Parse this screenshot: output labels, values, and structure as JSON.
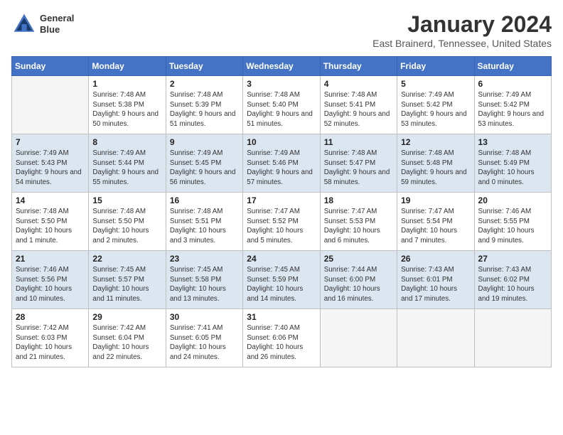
{
  "header": {
    "logo_line1": "General",
    "logo_line2": "Blue",
    "month": "January 2024",
    "location": "East Brainerd, Tennessee, United States"
  },
  "weekdays": [
    "Sunday",
    "Monday",
    "Tuesday",
    "Wednesday",
    "Thursday",
    "Friday",
    "Saturday"
  ],
  "weeks": [
    [
      {
        "day": "",
        "sunrise": "",
        "sunset": "",
        "daylight": ""
      },
      {
        "day": "1",
        "sunrise": "Sunrise: 7:48 AM",
        "sunset": "Sunset: 5:38 PM",
        "daylight": "Daylight: 9 hours and 50 minutes."
      },
      {
        "day": "2",
        "sunrise": "Sunrise: 7:48 AM",
        "sunset": "Sunset: 5:39 PM",
        "daylight": "Daylight: 9 hours and 51 minutes."
      },
      {
        "day": "3",
        "sunrise": "Sunrise: 7:48 AM",
        "sunset": "Sunset: 5:40 PM",
        "daylight": "Daylight: 9 hours and 51 minutes."
      },
      {
        "day": "4",
        "sunrise": "Sunrise: 7:48 AM",
        "sunset": "Sunset: 5:41 PM",
        "daylight": "Daylight: 9 hours and 52 minutes."
      },
      {
        "day": "5",
        "sunrise": "Sunrise: 7:49 AM",
        "sunset": "Sunset: 5:42 PM",
        "daylight": "Daylight: 9 hours and 53 minutes."
      },
      {
        "day": "6",
        "sunrise": "Sunrise: 7:49 AM",
        "sunset": "Sunset: 5:42 PM",
        "daylight": "Daylight: 9 hours and 53 minutes."
      }
    ],
    [
      {
        "day": "7",
        "sunrise": "Sunrise: 7:49 AM",
        "sunset": "Sunset: 5:43 PM",
        "daylight": "Daylight: 9 hours and 54 minutes."
      },
      {
        "day": "8",
        "sunrise": "Sunrise: 7:49 AM",
        "sunset": "Sunset: 5:44 PM",
        "daylight": "Daylight: 9 hours and 55 minutes."
      },
      {
        "day": "9",
        "sunrise": "Sunrise: 7:49 AM",
        "sunset": "Sunset: 5:45 PM",
        "daylight": "Daylight: 9 hours and 56 minutes."
      },
      {
        "day": "10",
        "sunrise": "Sunrise: 7:49 AM",
        "sunset": "Sunset: 5:46 PM",
        "daylight": "Daylight: 9 hours and 57 minutes."
      },
      {
        "day": "11",
        "sunrise": "Sunrise: 7:48 AM",
        "sunset": "Sunset: 5:47 PM",
        "daylight": "Daylight: 9 hours and 58 minutes."
      },
      {
        "day": "12",
        "sunrise": "Sunrise: 7:48 AM",
        "sunset": "Sunset: 5:48 PM",
        "daylight": "Daylight: 9 hours and 59 minutes."
      },
      {
        "day": "13",
        "sunrise": "Sunrise: 7:48 AM",
        "sunset": "Sunset: 5:49 PM",
        "daylight": "Daylight: 10 hours and 0 minutes."
      }
    ],
    [
      {
        "day": "14",
        "sunrise": "Sunrise: 7:48 AM",
        "sunset": "Sunset: 5:50 PM",
        "daylight": "Daylight: 10 hours and 1 minute."
      },
      {
        "day": "15",
        "sunrise": "Sunrise: 7:48 AM",
        "sunset": "Sunset: 5:50 PM",
        "daylight": "Daylight: 10 hours and 2 minutes."
      },
      {
        "day": "16",
        "sunrise": "Sunrise: 7:48 AM",
        "sunset": "Sunset: 5:51 PM",
        "daylight": "Daylight: 10 hours and 3 minutes."
      },
      {
        "day": "17",
        "sunrise": "Sunrise: 7:47 AM",
        "sunset": "Sunset: 5:52 PM",
        "daylight": "Daylight: 10 hours and 5 minutes."
      },
      {
        "day": "18",
        "sunrise": "Sunrise: 7:47 AM",
        "sunset": "Sunset: 5:53 PM",
        "daylight": "Daylight: 10 hours and 6 minutes."
      },
      {
        "day": "19",
        "sunrise": "Sunrise: 7:47 AM",
        "sunset": "Sunset: 5:54 PM",
        "daylight": "Daylight: 10 hours and 7 minutes."
      },
      {
        "day": "20",
        "sunrise": "Sunrise: 7:46 AM",
        "sunset": "Sunset: 5:55 PM",
        "daylight": "Daylight: 10 hours and 9 minutes."
      }
    ],
    [
      {
        "day": "21",
        "sunrise": "Sunrise: 7:46 AM",
        "sunset": "Sunset: 5:56 PM",
        "daylight": "Daylight: 10 hours and 10 minutes."
      },
      {
        "day": "22",
        "sunrise": "Sunrise: 7:45 AM",
        "sunset": "Sunset: 5:57 PM",
        "daylight": "Daylight: 10 hours and 11 minutes."
      },
      {
        "day": "23",
        "sunrise": "Sunrise: 7:45 AM",
        "sunset": "Sunset: 5:58 PM",
        "daylight": "Daylight: 10 hours and 13 minutes."
      },
      {
        "day": "24",
        "sunrise": "Sunrise: 7:45 AM",
        "sunset": "Sunset: 5:59 PM",
        "daylight": "Daylight: 10 hours and 14 minutes."
      },
      {
        "day": "25",
        "sunrise": "Sunrise: 7:44 AM",
        "sunset": "Sunset: 6:00 PM",
        "daylight": "Daylight: 10 hours and 16 minutes."
      },
      {
        "day": "26",
        "sunrise": "Sunrise: 7:43 AM",
        "sunset": "Sunset: 6:01 PM",
        "daylight": "Daylight: 10 hours and 17 minutes."
      },
      {
        "day": "27",
        "sunrise": "Sunrise: 7:43 AM",
        "sunset": "Sunset: 6:02 PM",
        "daylight": "Daylight: 10 hours and 19 minutes."
      }
    ],
    [
      {
        "day": "28",
        "sunrise": "Sunrise: 7:42 AM",
        "sunset": "Sunset: 6:03 PM",
        "daylight": "Daylight: 10 hours and 21 minutes."
      },
      {
        "day": "29",
        "sunrise": "Sunrise: 7:42 AM",
        "sunset": "Sunset: 6:04 PM",
        "daylight": "Daylight: 10 hours and 22 minutes."
      },
      {
        "day": "30",
        "sunrise": "Sunrise: 7:41 AM",
        "sunset": "Sunset: 6:05 PM",
        "daylight": "Daylight: 10 hours and 24 minutes."
      },
      {
        "day": "31",
        "sunrise": "Sunrise: 7:40 AM",
        "sunset": "Sunset: 6:06 PM",
        "daylight": "Daylight: 10 hours and 26 minutes."
      },
      {
        "day": "",
        "sunrise": "",
        "sunset": "",
        "daylight": ""
      },
      {
        "day": "",
        "sunrise": "",
        "sunset": "",
        "daylight": ""
      },
      {
        "day": "",
        "sunrise": "",
        "sunset": "",
        "daylight": ""
      }
    ]
  ]
}
